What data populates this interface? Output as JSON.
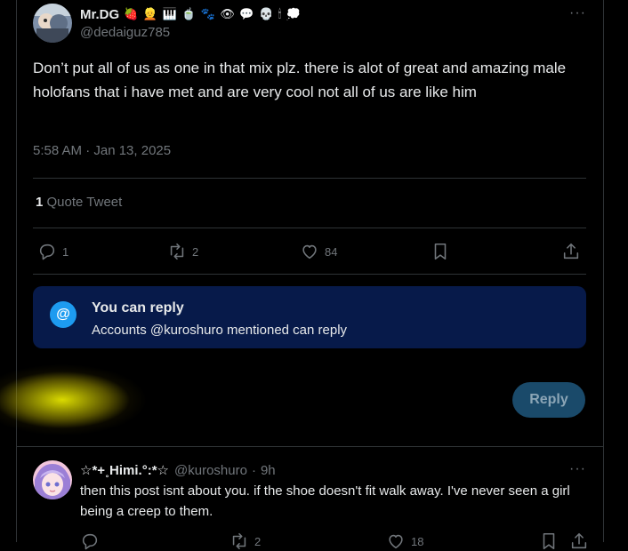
{
  "tweet": {
    "display_name": "Mr.DG",
    "name_emojis": [
      "🍓",
      "👱",
      "🎹",
      "🍵",
      "🐾",
      "👁",
      "💬",
      "💀",
      "🕯",
      "💭"
    ],
    "handle": "@dedaiguz785",
    "more_label": "···",
    "text": "Don’t put all of us as one in that mix plz. there is alot of great and amazing male holofans that i have met and are very cool not all of us are like him",
    "timestamp": "5:58 AM · Jan 13, 2025",
    "quote_count": "1",
    "quote_label": "Quote Tweet",
    "actions": {
      "replies": "1",
      "retweets": "2",
      "likes": "84"
    }
  },
  "reply_restriction": {
    "icon_label": "@",
    "title": "You can reply",
    "subtitle": "Accounts @kuroshuro mentioned can reply"
  },
  "composer": {
    "reply_button": "Reply"
  },
  "reply_tweet": {
    "display_name": "☆*+˳Himi.°:*☆",
    "handle": "@kuroshuro",
    "separator": "·",
    "time": "9h",
    "more_label": "···",
    "text": "then this post isnt about you. if the shoe doesn't fit walk away. I've never seen a girl being a creep to them.",
    "actions": {
      "replies": "",
      "retweets": "2",
      "likes": "18"
    }
  }
}
